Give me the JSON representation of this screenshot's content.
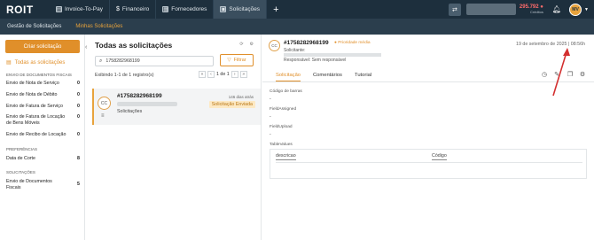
{
  "topbar": {
    "logo": "ROIT",
    "tabs": [
      {
        "label": "Invoice-To-Pay"
      },
      {
        "label": "Financeiro"
      },
      {
        "label": "Fornecedores"
      },
      {
        "label": "Solicitações"
      }
    ],
    "add": "+",
    "balance": "295.792 ●",
    "balance_label": "Créditos",
    "avatar": "MV"
  },
  "subnav": {
    "items": [
      "Gestão de Solicitações",
      "Minhas Solicitações"
    ]
  },
  "sidebar": {
    "create_button": "Criar solicitação",
    "all_requests": "Todas as solicitações",
    "section_fiscal": "ENVIO DE DOCUMENTOS FISCAIS",
    "fiscal_items": [
      {
        "label": "Envio de Nota de Serviço",
        "count": "0"
      },
      {
        "label": "Envio de Nota de Débito",
        "count": "0"
      },
      {
        "label": "Envio de Fatura de Serviço",
        "count": "0"
      },
      {
        "label": "Envio de Fatura de Locação de Bens Móveis",
        "count": "0"
      },
      {
        "label": "Envio de Recibo de Locação",
        "count": "0"
      }
    ],
    "section_prefs": "PREFERÊNCIAS",
    "prefs_items": [
      {
        "label": "Data de Corte",
        "count": "8"
      }
    ],
    "section_requests": "SOLICITAÇÕES",
    "requests_items": [
      {
        "label": "Envio de Documentos Fiscais",
        "count": "5"
      }
    ]
  },
  "list": {
    "title": "Todas as solicitações",
    "search_value": "1758282968199",
    "filter_label": "Filtrar",
    "pagination_text": "Exibindo 1-1 de 1 registro(s)",
    "page_indicator": "1 de 1",
    "card": {
      "avatar": "CC",
      "id": "#1758282968199",
      "days": "146 dias atrás",
      "status": "Solicitação Enviada",
      "type": "Solicitações"
    }
  },
  "detail": {
    "avatar": "CC",
    "id": "#1758282968199",
    "priority": "● Prioridade média",
    "date": "19 de setembro de 2025 | 08:56h",
    "requester_label": "Solicitante:",
    "responsible_label": "Responsável:",
    "responsible_value": "Sem responsável",
    "tabs": [
      "Solicitação",
      "Comentários",
      "Tutorial"
    ],
    "fields": [
      {
        "label": "Código de barras",
        "value": "-"
      },
      {
        "label": "FieldAssigned",
        "value": "-"
      },
      {
        "label": "FieldUpload",
        "value": "-"
      },
      {
        "label": "TableValues",
        "value": ""
      }
    ],
    "table_headers": [
      "descricao",
      "Código"
    ]
  }
}
